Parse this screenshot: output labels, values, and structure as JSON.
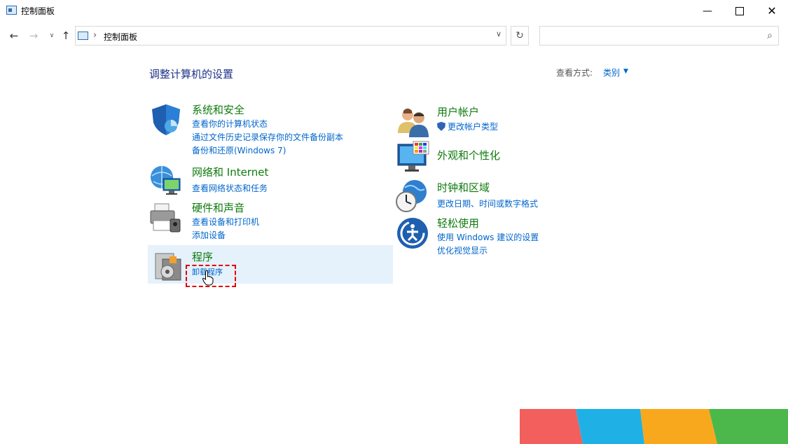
{
  "window": {
    "title": "控制面板"
  },
  "address": {
    "path": "控制面板",
    "search_placeholder": ""
  },
  "header": {
    "title": "调整计算机的设置",
    "view_by_label": "查看方式:",
    "view_by_value": "类别"
  },
  "categories": {
    "system": {
      "title": "系统和安全",
      "links": [
        "查看你的计算机状态",
        "通过文件历史记录保存你的文件备份副本",
        "备份和还原(Windows 7)"
      ]
    },
    "network": {
      "title": "网络和 Internet",
      "links": [
        "查看网络状态和任务"
      ]
    },
    "hardware": {
      "title": "硬件和声音",
      "links": [
        "查看设备和打印机",
        "添加设备"
      ]
    },
    "programs": {
      "title": "程序",
      "links": [
        "卸载程序"
      ]
    },
    "users": {
      "title": "用户帐户",
      "links": [
        "更改帐户类型"
      ]
    },
    "appearance": {
      "title": "外观和个性化",
      "links": []
    },
    "clock": {
      "title": "时钟和区域",
      "links": [
        "更改日期、时间或数字格式"
      ]
    },
    "ease": {
      "title": "轻松使用",
      "links": [
        "使用 Windows 建议的设置",
        "优化视觉显示"
      ]
    }
  },
  "colors": {
    "heading": "#1e3287",
    "category": "#0e7a0d",
    "link": "#0066cc",
    "highlight": "#e5f1fb",
    "annotation": "#e00000"
  }
}
